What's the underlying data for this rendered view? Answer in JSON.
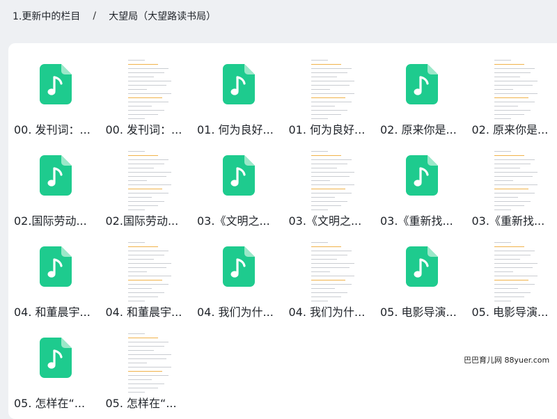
{
  "breadcrumb": {
    "folder": "1.更新中的栏目",
    "separator": "/",
    "current": "大望局（大望路读书局）"
  },
  "files": [
    {
      "name": "00. 发刊词：...",
      "type": "audio"
    },
    {
      "name": "00. 发刊词：...",
      "type": "document"
    },
    {
      "name": "01. 何为良好...",
      "type": "audio"
    },
    {
      "name": "01. 何为良好...",
      "type": "document"
    },
    {
      "name": "02. 原来你是...",
      "type": "audio"
    },
    {
      "name": "02. 原来你是...",
      "type": "document"
    },
    {
      "name": "02.国际劳动...",
      "type": "audio"
    },
    {
      "name": "02.国际劳动...",
      "type": "document"
    },
    {
      "name": "03.《文明之...",
      "type": "audio"
    },
    {
      "name": "03.《文明之...",
      "type": "document"
    },
    {
      "name": "03.《重新找...",
      "type": "audio"
    },
    {
      "name": "03.《重新找...",
      "type": "document"
    },
    {
      "name": "04. 和董晨宇...",
      "type": "audio"
    },
    {
      "name": "04. 和董晨宇...",
      "type": "document"
    },
    {
      "name": "04. 我们为什...",
      "type": "audio"
    },
    {
      "name": "04. 我们为什...",
      "type": "document"
    },
    {
      "name": "05. 电影导演...",
      "type": "audio"
    },
    {
      "name": "05. 电影导演...",
      "type": "document"
    },
    {
      "name": "05. 怎样在“...",
      "type": "audio"
    },
    {
      "name": "05. 怎样在“...",
      "type": "document"
    }
  ],
  "icons": {
    "audio": "music-note-file-icon",
    "document": "document-thumbnail"
  },
  "colors": {
    "audio_icon": "#1ecb8e",
    "background": "#eef0f3",
    "panel": "#ffffff"
  },
  "watermark": "巴巴育儿网 88yuer.com"
}
